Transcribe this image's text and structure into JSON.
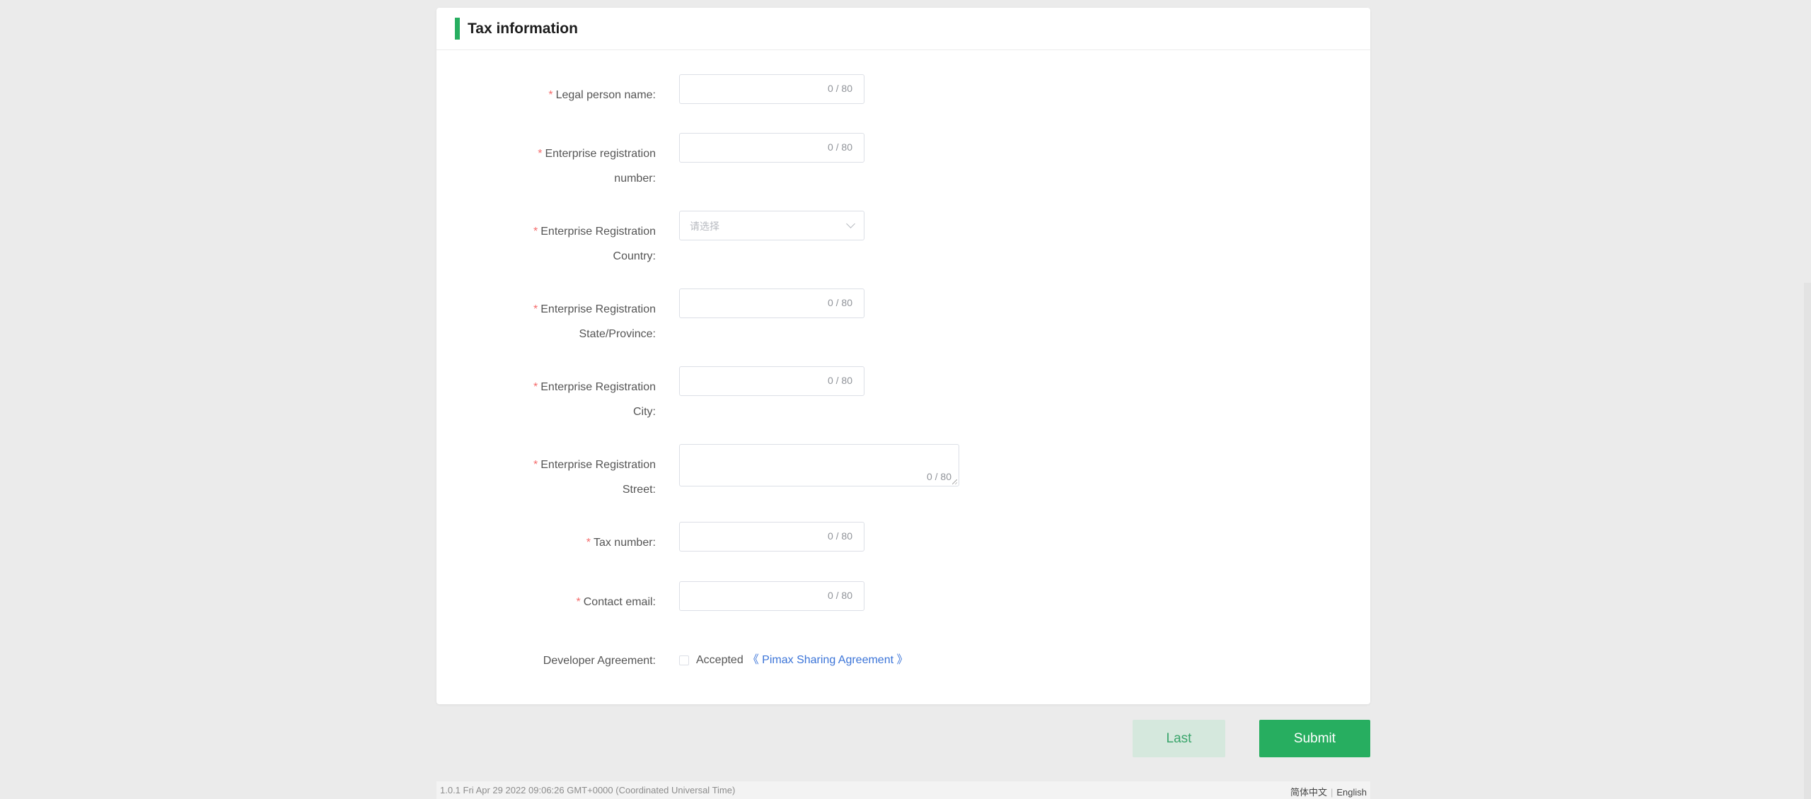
{
  "section": {
    "title": "Tax information",
    "accent_color": "#27ae60"
  },
  "form": {
    "legal_person_name": {
      "label": "Legal person name:",
      "required": true,
      "counter": "0 / 80",
      "value": ""
    },
    "enterprise_registration_number": {
      "label_line1": "Enterprise registration",
      "label_line2": "number:",
      "required": true,
      "counter": "0 / 80",
      "value": ""
    },
    "enterprise_registration_country": {
      "label_line1": "Enterprise Registration",
      "label_line2": "Country:",
      "required": true,
      "placeholder": "请选择"
    },
    "enterprise_registration_state": {
      "label_line1": "Enterprise Registration",
      "label_line2": "State/Province:",
      "required": true,
      "counter": "0 / 80",
      "value": ""
    },
    "enterprise_registration_city": {
      "label_line1": "Enterprise Registration",
      "label_line2": "City:",
      "required": true,
      "counter": "0 / 80",
      "value": ""
    },
    "enterprise_registration_street": {
      "label_line1": "Enterprise Registration",
      "label_line2": "Street:",
      "required": true,
      "counter": "0 / 80",
      "value": ""
    },
    "tax_number": {
      "label": "Tax number:",
      "required": true,
      "counter": "0 / 80",
      "value": ""
    },
    "contact_email": {
      "label": "Contact email:",
      "required": true,
      "counter": "0 / 80",
      "value": ""
    },
    "developer_agreement": {
      "label": "Developer Agreement:",
      "checkbox_label": "Accepted",
      "link_text": "《 Pimax Sharing Agreement 》",
      "checked": false
    }
  },
  "buttons": {
    "last": "Last",
    "submit": "Submit"
  },
  "footer": {
    "version": "1.0.1 Fri Apr 29 2022 09:06:26 GMT+0000 (Coordinated Universal Time)",
    "lang_zh": "简体中文",
    "lang_en": "English"
  },
  "required_mark": "*"
}
